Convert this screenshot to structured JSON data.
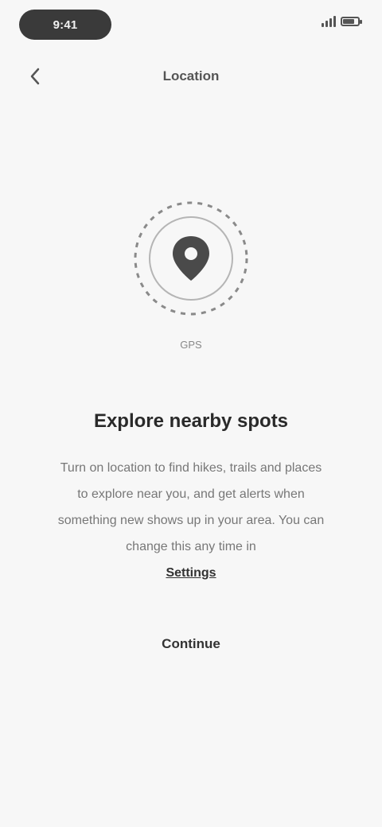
{
  "status_bar": {
    "time": "9:41",
    "battery_level": 0.8
  },
  "nav": {
    "back_icon": "chevron-left-icon",
    "title": "Location"
  },
  "illustration": {
    "icon": "map-pin-icon",
    "caption": "GPS"
  },
  "content": {
    "headline": "Explore nearby spots",
    "body": "Turn on location to find hikes, trails and places to explore near you, and get alerts when something new shows up in your area. You can change this any time in",
    "body_link": "Settings"
  },
  "actions": {
    "primary_label": "Continue"
  }
}
